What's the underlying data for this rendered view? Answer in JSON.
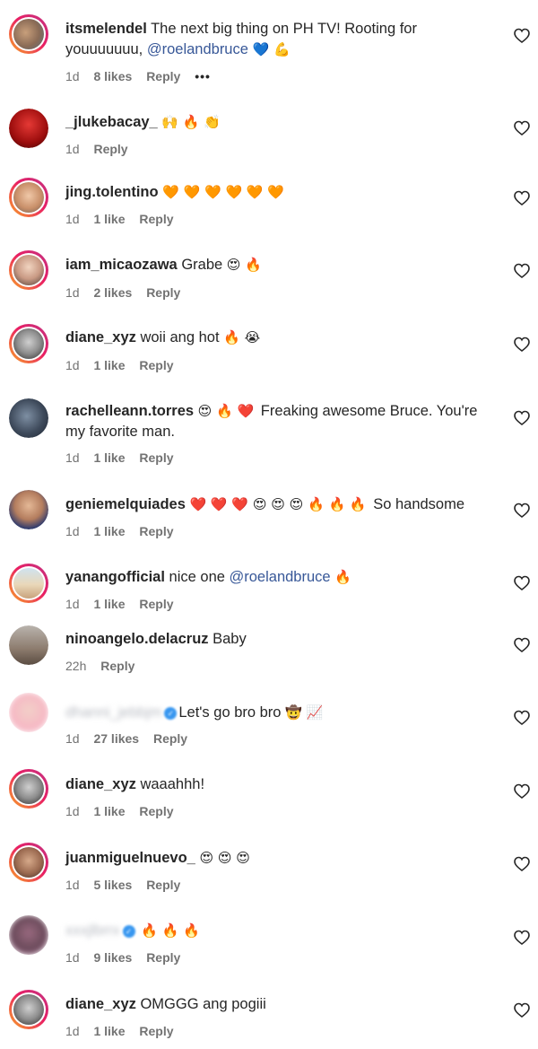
{
  "comments": [
    {
      "username": "itsmelendel",
      "text": "The next big thing on PH TV! Rooting for youuuuuuu, ",
      "mention": "@roelandbruce",
      "emojis": "💙 💪",
      "time": "1d",
      "likes": "8 likes",
      "reply": "Reply",
      "more": "•••"
    },
    {
      "username": "_jlukebacay_",
      "text": "",
      "emojis": "🙌 🔥 👏",
      "time": "1d",
      "likes": "",
      "reply": "Reply"
    },
    {
      "username": "jing.tolentino",
      "text": "",
      "emojis": "🧡 🧡 🧡 🧡 🧡 🧡",
      "time": "1d",
      "likes": "1 like",
      "reply": "Reply"
    },
    {
      "username": "iam_micaozawa",
      "text": "Grabe",
      "emojis": "😍 🔥",
      "time": "1d",
      "likes": "2 likes",
      "reply": "Reply"
    },
    {
      "username": "diane_xyz",
      "text": "woii ang hot",
      "emojis": "🔥 😭",
      "time": "1d",
      "likes": "1 like",
      "reply": "Reply"
    },
    {
      "username": "rachelleann.torres",
      "emojis_before": "😍 🔥 ❤️",
      "text": "Freaking awesome Bruce. You're my favorite man.",
      "time": "1d",
      "likes": "1 like",
      "reply": "Reply"
    },
    {
      "username": "geniemelquiades",
      "emojis_before": "❤️ ❤️ ❤️ 😍 😍 😍 🔥 🔥 🔥",
      "text": "So handsome",
      "time": "1d",
      "likes": "1 like",
      "reply": "Reply"
    },
    {
      "username": "yanangofficial",
      "text": "nice one ",
      "mention": "@roelandbruce",
      "emojis": "🔥",
      "time": "1d",
      "likes": "1 like",
      "reply": "Reply"
    },
    {
      "username": "ninoangelo.delacruz",
      "text": "Baby",
      "time": "22h",
      "likes": "",
      "reply": "Reply"
    },
    {
      "username": "dhanni_jebbjm",
      "text": "Let's go bro bro",
      "emojis": "🤠 📈",
      "time": "1d",
      "likes": "27 likes",
      "reply": "Reply"
    },
    {
      "username": "diane_xyz",
      "text": "waaahhh!",
      "time": "1d",
      "likes": "1 like",
      "reply": "Reply"
    },
    {
      "username": "juanmiguelnuevo_",
      "text": "",
      "emojis": "😍 😍 😍",
      "time": "1d",
      "likes": "5 likes",
      "reply": "Reply"
    },
    {
      "username": "xxxjlbrrx",
      "text": "",
      "emojis": "🔥 🔥 🔥",
      "time": "1d",
      "likes": "9 likes",
      "reply": "Reply"
    },
    {
      "username": "diane_xyz",
      "text": "OMGGG ang pogiii",
      "time": "1d",
      "likes": "1 like",
      "reply": "Reply"
    }
  ],
  "colors": {
    "text": "#262626",
    "meta": "#737373",
    "mention": "#385898",
    "ring_start": "#f9a825",
    "ring_end": "#c13584"
  }
}
